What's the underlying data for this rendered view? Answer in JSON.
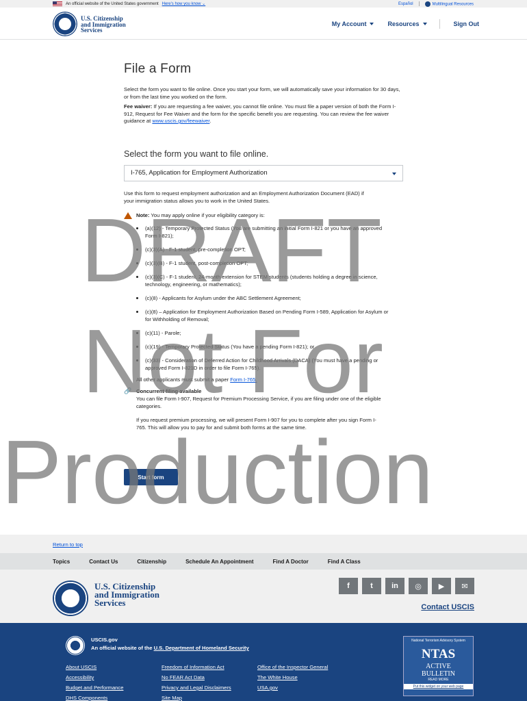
{
  "banner": {
    "official_text": "An official website of the United States government",
    "how_link": "Here's how you know ⌄",
    "espanol": "Español",
    "multilingual": "Multilingual Resources"
  },
  "header": {
    "brand_line1": "U.S. Citizenship",
    "brand_line2": "and Immigration",
    "brand_line3": "Services",
    "nav": {
      "my_account": "My Account",
      "resources": "Resources",
      "sign_out": "Sign Out"
    }
  },
  "main": {
    "title": "File a Form",
    "intro": "Select the form you want to file online. Once you start your form, we will automatically save your information for 30 days, or from the last time you worked on the form.",
    "fee_label": "Fee waiver:",
    "fee_text": " If you are requesting a fee waiver, you cannot file online.  You must file a paper version of both the Form I-912, Request for Fee Waiver and the form for the specific benefit you are requesting. You can review the fee waiver guidance at ",
    "fee_link": "www.uscis.gov/feewaiver",
    "fee_end": ".",
    "select_title": "Select the form you want to file online.",
    "select_value": "I-765, Application for Employment Authorization",
    "description": "Use this form to request employment authorization and an Employment Authorization Document (EAD) if your immigration status allows you to work in the United States.",
    "note_label": "Note:",
    "note_text": " You may apply online if your eligibility category is:",
    "categories": [
      "(a)(12) - Temporary Protected Status (You are submitting an initial Form I-821 or you have an approved Form I-821);",
      "(c)(3)(A) - F-1 student, pre-completion OPT;",
      "(c)(3)(B) - F-1 student, post-completion OPT;",
      "(c)(3)(C) - F-1 student, 24-month extension for STEM students (students holding a degree in science, technology, engineering, or mathematics);",
      "(c)(8) - Applicants for Asylum under the ABC Settlement Agreement;",
      "(c)(8) – Application for Employment Authorization Based on Pending Form I-589, Application for Asylum or for Withholding of Removal;",
      "(c)(11) - Parole;",
      "(c)(19) - Temporary Protected Status (You have a pending Form I-821); or",
      "(c)(33) - Consideration of Deferred Action for Childhood Arrivals (DACA) (You must have a pending or approved Form I-821D in order to file Form I-765)."
    ],
    "other_text": "All other applicants must submit a paper ",
    "other_link": "Form I-765.",
    "concurrent_title": "Concurrent filing available",
    "concurrent_text": "You can file Form I-907, Request for Premium Processing Service, if you are filing under one of the eligible categories.",
    "premium_text": "If you request premium processing, we will present Form I-907 for you to complete after you sign Form I-765. This will allow you to pay for and submit both forms at the same time.",
    "start_button": "Start form"
  },
  "watermark": {
    "line1": "DRAFT",
    "line2": "Not For",
    "line3": "Production"
  },
  "footer": {
    "return_to_top": "Return to top",
    "nav": [
      "Topics",
      "Contact Us",
      "Citizenship",
      "Schedule An Appointment",
      "Find A Doctor",
      "Find A Class"
    ],
    "brand_line1": "U.S. Citizenship",
    "brand_line2": "and Immigration",
    "brand_line3": "Services",
    "socials": [
      "f",
      "t",
      "in",
      "◎",
      "▶",
      "✉"
    ],
    "contact": "Contact USCIS",
    "gov_title": "USCIS.gov",
    "gov_sub_prefix": "An official website of the ",
    "gov_sub_link": "U.S. Department of Homeland Security",
    "links": [
      "About USCIS",
      "Freedom of Information Act",
      "Office of the Inspector General",
      "Accessibility",
      "No FEAR Act Data",
      "The White House",
      "Budget and Performance",
      "Privacy and Legal Disclaimers",
      "USA.gov",
      "DHS Components",
      "Site Map",
      ""
    ],
    "ntas": {
      "header": "National Terrorism Advisory System",
      "logo": "NTAS",
      "active": "ACTIVE",
      "bulletin": "BULLETIN",
      "more": "READ MORE",
      "put": "Put this widget on your web page"
    }
  }
}
